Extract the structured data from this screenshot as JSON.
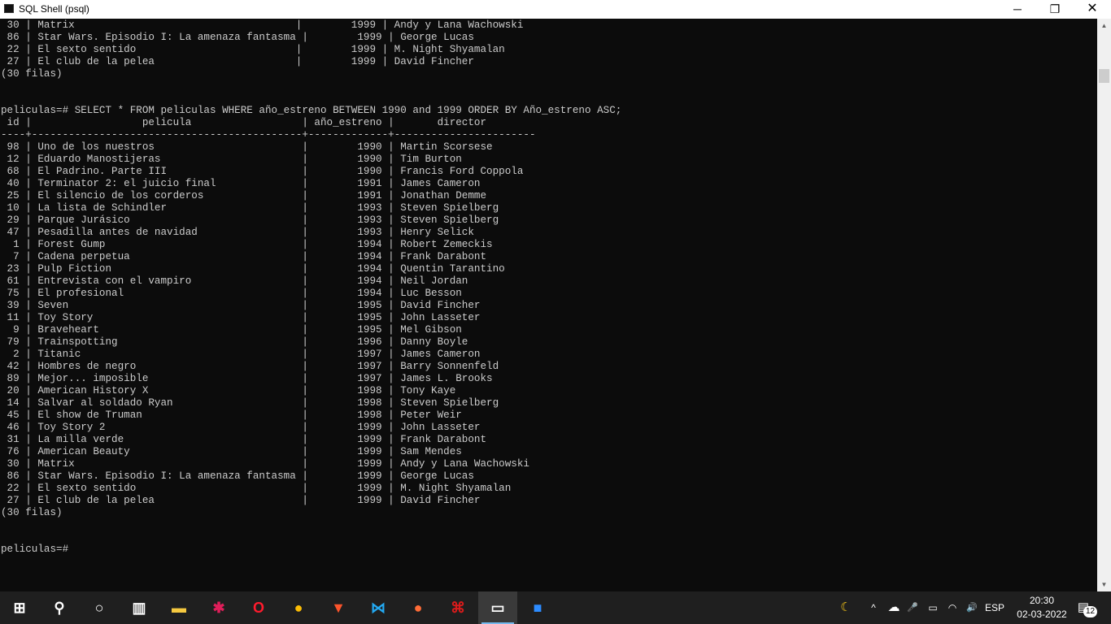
{
  "window": {
    "title": "SQL Shell (psql)",
    "min_glyph": "─",
    "max_glyph": "❐",
    "close_glyph": "✕"
  },
  "console": {
    "lines": [
      " 30 | Matrix                                    |        1999 | Andy y Lana Wachowski",
      " 86 | Star Wars. Episodio I: La amenaza fantasma |        1999 | George Lucas",
      " 22 | El sexto sentido                          |        1999 | M. Night Shyamalan",
      " 27 | El club de la pelea                       |        1999 | David Fincher",
      "(30 filas)",
      "",
      "",
      "peliculas=# SELECT * FROM peliculas WHERE año_estreno BETWEEN 1990 and 1999 ORDER BY Año_estreno ASC;",
      " id |                  pelicula                  | año_estreno |       director",
      "----+--------------------------------------------+-------------+-----------------------",
      " 98 | Uno de los nuestros                        |        1990 | Martin Scorsese",
      " 12 | Eduardo Manostijeras                       |        1990 | Tim Burton",
      " 68 | El Padrino. Parte III                      |        1990 | Francis Ford Coppola",
      " 40 | Terminator 2: el juicio final              |        1991 | James Cameron",
      " 25 | El silencio de los corderos                |        1991 | Jonathan Demme",
      " 10 | La lista de Schindler                      |        1993 | Steven Spielberg",
      " 29 | Parque Jurásico                            |        1993 | Steven Spielberg",
      " 47 | Pesadilla antes de navidad                 |        1993 | Henry Selick",
      "  1 | Forest Gump                                |        1994 | Robert Zemeckis",
      "  7 | Cadena perpetua                            |        1994 | Frank Darabont",
      " 23 | Pulp Fiction                               |        1994 | Quentin Tarantino",
      " 61 | Entrevista con el vampiro                  |        1994 | Neil Jordan",
      " 75 | El profesional                             |        1994 | Luc Besson",
      " 39 | Seven                                      |        1995 | David Fincher",
      " 11 | Toy Story                                  |        1995 | John Lasseter",
      "  9 | Braveheart                                 |        1995 | Mel Gibson",
      " 79 | Trainspotting                              |        1996 | Danny Boyle",
      "  2 | Titanic                                    |        1997 | James Cameron",
      " 42 | Hombres de negro                           |        1997 | Barry Sonnenfeld",
      " 89 | Mejor... imposible                         |        1997 | James L. Brooks",
      " 20 | American History X                         |        1998 | Tony Kaye",
      " 14 | Salvar al soldado Ryan                     |        1998 | Steven Spielberg",
      " 45 | El show de Truman                          |        1998 | Peter Weir",
      " 46 | Toy Story 2                                |        1999 | John Lasseter",
      " 31 | La milla verde                             |        1999 | Frank Darabont",
      " 76 | American Beauty                            |        1999 | Sam Mendes",
      " 30 | Matrix                                     |        1999 | Andy y Lana Wachowski",
      " 86 | Star Wars. Episodio I: La amenaza fantasma |        1999 | George Lucas",
      " 22 | El sexto sentido                           |        1999 | M. Night Shyamalan",
      " 27 | El club de la pelea                        |        1999 | David Fincher",
      "(30 filas)",
      "",
      "",
      "peliculas=#"
    ]
  },
  "taskbar": {
    "apps": [
      {
        "name": "start",
        "glyph": "⊞",
        "color": "#ffffff"
      },
      {
        "name": "search",
        "glyph": "⚲",
        "color": "#ffffff"
      },
      {
        "name": "cortana",
        "glyph": "○",
        "color": "#ffffff"
      },
      {
        "name": "task-view",
        "glyph": "▥",
        "color": "#ffffff"
      },
      {
        "name": "file-explorer",
        "glyph": "▬",
        "color": "#f6c940"
      },
      {
        "name": "slack",
        "glyph": "✱",
        "color": "#e01e5a"
      },
      {
        "name": "opera",
        "glyph": "O",
        "color": "#ff1b2d"
      },
      {
        "name": "chrome",
        "glyph": "●",
        "color": "#fbbc05"
      },
      {
        "name": "brave",
        "glyph": "▼",
        "color": "#fb542b"
      },
      {
        "name": "vscode",
        "glyph": "⋈",
        "color": "#23a9f2"
      },
      {
        "name": "postman",
        "glyph": "●",
        "color": "#ff6c37"
      },
      {
        "name": "acrobat",
        "glyph": "⌘",
        "color": "#d81b1b"
      },
      {
        "name": "sql-shell",
        "glyph": "▭",
        "color": "#ffffff",
        "active": true
      },
      {
        "name": "zoom",
        "glyph": "■",
        "color": "#2d8cff"
      }
    ],
    "tray": {
      "night_glyph": "☾",
      "chevron_glyph": "^",
      "cloud_glyph": "☁",
      "mic_glyph": "🎤",
      "battery_glyph": "▭",
      "wifi_glyph": "◠",
      "volume_glyph": "🔊",
      "language": "ESP",
      "time": "20:30",
      "date": "02-03-2022",
      "notification_glyph": "▤",
      "notification_count": "12"
    }
  }
}
